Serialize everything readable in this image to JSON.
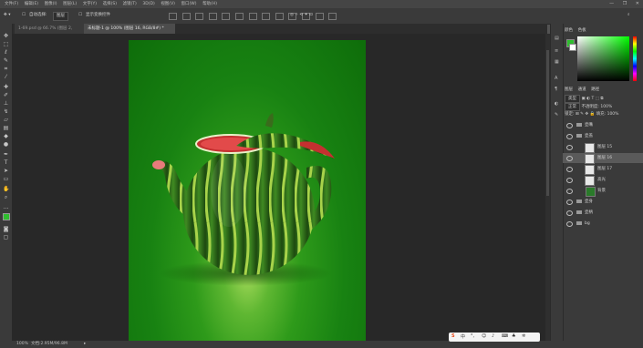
{
  "menu": {
    "items": [
      "文件(F)",
      "编辑(E)",
      "图像(I)",
      "图层(L)",
      "文字(Y)",
      "选择(S)",
      "滤镜(T)",
      "3D(D)",
      "视图(V)",
      "窗口(W)",
      "帮助(H)"
    ]
  },
  "window_controls": {
    "minimize": "—",
    "restore": "❐",
    "close": "✕"
  },
  "options_bar": {
    "auto_select_label": "自动选择:",
    "auto_select_value": "图层",
    "show_transform_label": "显示变换控件"
  },
  "tabs": [
    {
      "label": "1-69.psd @ 66.7% (图层 2, RGB/8) *",
      "active": false
    },
    {
      "label": "未标题-1 @ 100% (图层 16, RGB/8#) *",
      "active": true
    }
  ],
  "status_bar": {
    "zoom": "100%",
    "doc": "文档:2.95M/96.8M"
  },
  "ime": {
    "logo": "S",
    "mode": "中",
    "punct": "°,"
  },
  "color_panel": {
    "tabs": [
      "颜色",
      "色板"
    ],
    "foreground": "#2ebd2e",
    "background": "#ffffff"
  },
  "layers_panel": {
    "tabs": [
      "图层",
      "通道",
      "路径"
    ],
    "kind_label": "类型",
    "blend_mode": "正常",
    "opacity_label": "不透明度:",
    "opacity_value": "100%",
    "lock_label": "锁定:",
    "fill_label": "填充:",
    "fill_value": "100%",
    "layers": [
      {
        "name": "壶嘴",
        "type": "group",
        "indent": false,
        "selected": false
      },
      {
        "name": "壶盖",
        "type": "group",
        "indent": false,
        "selected": false
      },
      {
        "name": "图层 15",
        "type": "layer",
        "indent": true,
        "selected": false
      },
      {
        "name": "图层 16",
        "type": "layer",
        "indent": true,
        "selected": true
      },
      {
        "name": "图层 17",
        "type": "layer",
        "indent": true,
        "selected": false
      },
      {
        "name": "高光",
        "type": "layer",
        "indent": true,
        "selected": false
      },
      {
        "name": "背景",
        "type": "layer",
        "indent": false,
        "selected": false
      },
      {
        "name": "壶身",
        "type": "group",
        "indent": false,
        "selected": false
      },
      {
        "name": "壶柄",
        "type": "group",
        "indent": false,
        "selected": false
      },
      {
        "name": "bg",
        "type": "group",
        "indent": false,
        "selected": false
      }
    ]
  }
}
